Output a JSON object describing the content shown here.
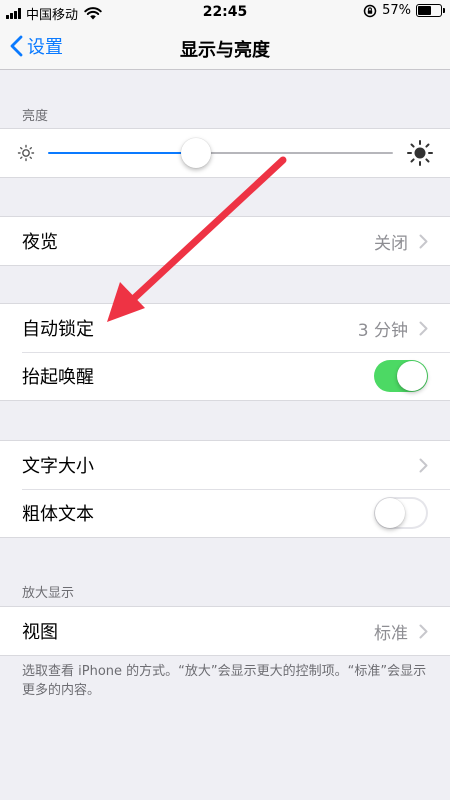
{
  "status": {
    "carrier": "中国移动",
    "time": "22:45",
    "battery_percent": "57%",
    "battery_level": 0.57
  },
  "nav": {
    "back_label": "设置",
    "title": "显示与亮度"
  },
  "brightness": {
    "header": "亮度",
    "level": 0.43
  },
  "night_shift": {
    "label": "夜览",
    "value": "关闭"
  },
  "auto_lock": {
    "label": "自动锁定",
    "value": "3 分钟"
  },
  "raise_to_wake": {
    "label": "抬起唤醒",
    "on": true
  },
  "text_size": {
    "label": "文字大小"
  },
  "bold_text": {
    "label": "粗体文本",
    "on": false
  },
  "zoom": {
    "header": "放大显示",
    "label": "视图",
    "value": "标准",
    "footer": "选取查看 iPhone 的方式。“放大”会显示更大的控制项。“标准”会显示更多的内容。"
  },
  "colors": {
    "accent": "#0a7aff",
    "toggle_on": "#4cd964",
    "arrow": "#ee3344"
  }
}
